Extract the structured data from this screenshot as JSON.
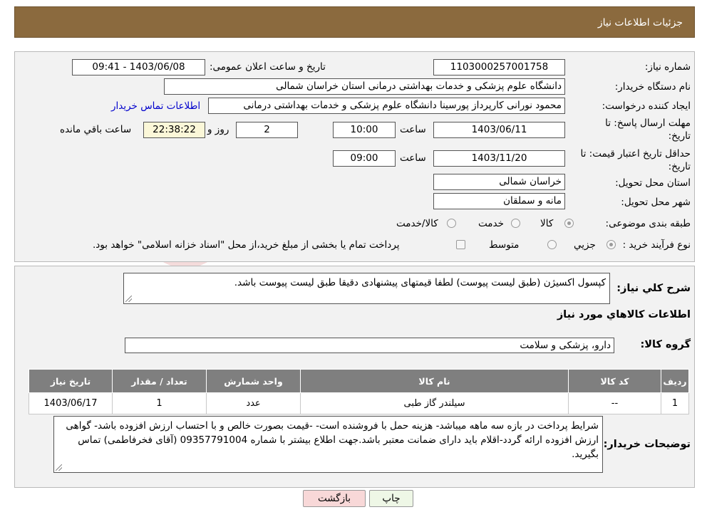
{
  "header": {
    "title": "جزئیات اطلاعات نیاز"
  },
  "details": {
    "need_number_label": "شماره نیاز:",
    "need_number": "1103000257001758",
    "announce_label": "تاریخ و ساعت اعلان عمومی:",
    "announce_value": "1403/06/08 - 09:41",
    "buyer_org_label": "نام دستگاه خریدار:",
    "buyer_org": "دانشگاه علوم پزشکی و خدمات بهداشتی درمانی استان خراسان شمالی",
    "requester_label": "ایجاد کننده درخواست:",
    "requester": "محمود نورانی کارپرداز پورسینا دانشگاه علوم پزشکی و خدمات بهداشتی درمانی",
    "contact_link": "اطلاعات تماس خریدار",
    "deadline_label": "مهلت ارسال پاسخ: تا تاریخ:",
    "deadline_date": "1403/06/11",
    "time_label": "ساعت",
    "deadline_time": "10:00",
    "days_value": "2",
    "days_label": "روز و",
    "remaining_value": "22:38:22",
    "remaining_label": "ساعت باقي مانده",
    "validity_label": "حداقل تاریخ اعتبار قیمت: تا تاریخ:",
    "validity_date": "1403/11/20",
    "validity_time": "09:00",
    "province_label": "استان محل تحویل:",
    "province": "خراسان شمالی",
    "city_label": "شهر محل تحویل:",
    "city": "مانه و سملقان",
    "category_label": "طبقه بندی موضوعی:",
    "category_options": [
      "کالا",
      "خدمت",
      "کالا/خدمت"
    ],
    "process_label": "نوع فرآیند خرید :",
    "process_options": [
      "جزيي",
      "متوسط"
    ],
    "process_note": "پرداخت تمام یا بخشی از مبلغ خرید،از محل \"اسناد خزانه اسلامی\" خواهد بود."
  },
  "summary": {
    "label": "شرح كلي نياز:",
    "text": "کپسول اکسیژن (طبق لیست پیوست) لطفا قیمتهای پیشنهادی دقیقا طبق لیست پیوست باشد.",
    "goods_heading": "اطلاعات كالاهاي مورد نياز",
    "group_label": "گروه كالا:",
    "group_value": "دارو، پزشکی و سلامت"
  },
  "table": {
    "headers": [
      "رديف",
      "كد كالا",
      "نام كالا",
      "واحد شمارش",
      "تعداد / مقدار",
      "تاريخ نياز"
    ],
    "rows": [
      [
        "1",
        "--",
        "سیلندر گاز طبی",
        "عدد",
        "1",
        "1403/06/17"
      ]
    ]
  },
  "buyer_notes": {
    "label": "توضيحات خريدار:",
    "text": "شرایط پرداخت در بازه سه ماهه میباشد- هزینه حمل با فروشنده است- -قیمت بصورت خالص و با احتساب ارزش افزوده باشد- گواهی ارزش افزوده ارائه گردد-اقلام باید دارای ضمانت معتبر باشد.جهت اطلاع بیشتر با شماره 09357791004 (آقای فخرفاطمی) تماس بگیرید."
  },
  "buttons": {
    "print": "چاپ",
    "back": "بازگشت"
  },
  "watermark": {
    "text": "AriaTender.neT"
  },
  "colors": {
    "header_bg": "#8b6a3e",
    "back_button_bg": "#f8d8d8",
    "print_button_bg": "#eef7e6"
  }
}
